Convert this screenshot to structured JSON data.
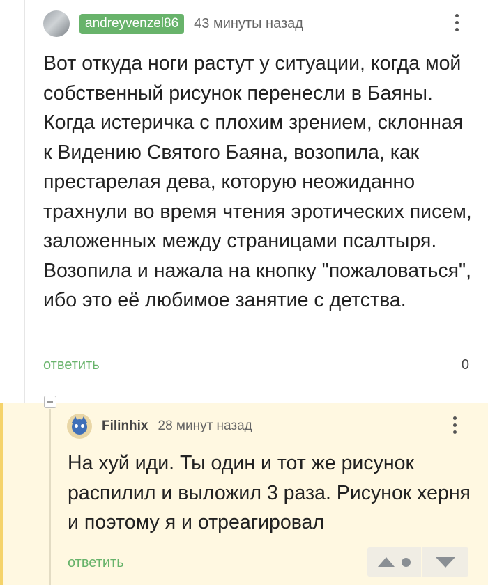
{
  "comment": {
    "username": "andreyvenzel86",
    "timestamp": "43 минуты назад",
    "text": "Вот откуда ноги растут у ситуации, когда мой собственный рисунок перенесли в Баяны. Когда истеричка с плохим зрением, склонная к Видению Святого Баяна, возопила, как престарелая дева, которую неожиданно трахнули во время чтения эротических писем, заложенных между страницами псалтыря. Возопила и нажала на кнопку \"пожаловаться\", ибо это её любимое занятие с детства.",
    "reply_label": "ответить",
    "rating": "0"
  },
  "reply": {
    "username": "Filinhix",
    "timestamp": "28 минут назад",
    "text": "На хуй иди. Ты один и тот же рисунок распилил и выложил 3 раза. Рисунок херня и поэтому я и отреагировал",
    "reply_label": "ответить"
  },
  "colors": {
    "accent_green": "#68b36b",
    "reply_background": "#fff8e1",
    "reply_accent": "#f5d36a"
  },
  "icons": {
    "more": "more-vertical-icon",
    "collapse": "collapse-minus-icon",
    "upvote": "triangle-up-icon",
    "downvote": "triangle-down-icon"
  }
}
